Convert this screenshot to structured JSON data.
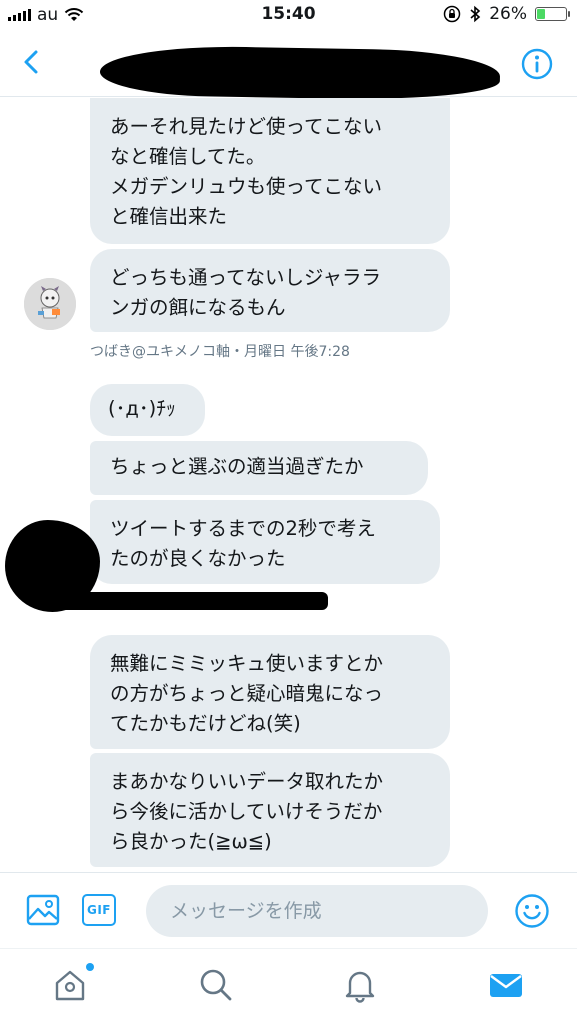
{
  "status_bar": {
    "carrier": "au",
    "time": "15:40",
    "battery_percent": "26%",
    "battery_level": 0.26
  },
  "header": {
    "back_icon": "chevron-left-icon",
    "info_icon": "info-circle-icon"
  },
  "messages": [
    {
      "text": "あーそれ見たけど使ってこない\nなと確信してた。\nメガデンリュウも使ってこない\nと確信出来た"
    },
    {
      "text": "どっちも通ってないしジャララ\nンガの餌になるもん"
    },
    {
      "meta": "つばき@ユキメノコ軸・月曜日 午後7:28"
    },
    {
      "text": "(･д･)ﾁｯ"
    },
    {
      "text": "ちょっと選ぶの適当過ぎたか"
    },
    {
      "text": "ツイートするまでの2秒で考え\nたのが良くなかった"
    },
    {
      "text": "無難にミミッキュ使いますとか\nの方がちょっと疑心暗鬼になっ\nてたかもだけどね(笑)"
    },
    {
      "text": "まあかなりいいデータ取れたか\nら今後に活かしていけそうだか\nら良かった(≧ω≦)"
    }
  ],
  "composer": {
    "placeholder": "メッセージを作成",
    "gif_label": "GIF"
  },
  "tabs": [
    "home",
    "search",
    "notifications",
    "messages"
  ],
  "colors": {
    "accent": "#1da1f2",
    "bubble": "#e6ecf0",
    "meta_text": "#657786"
  }
}
